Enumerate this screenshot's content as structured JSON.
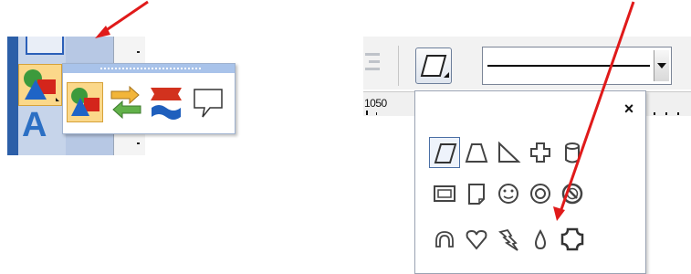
{
  "annotations": {
    "arrow_color": "#e01a1a"
  },
  "left_toolbox": {
    "active_tool_icon": "shapes-tool-icon",
    "text_tool_label": "A",
    "flyout": {
      "grip_icon": "flyout-grip-icon",
      "items": [
        {
          "icon": "basic-shapes-icon",
          "selected": true
        },
        {
          "icon": "connector-arrows-icon",
          "selected": false
        },
        {
          "icon": "banner-shapes-icon",
          "selected": false
        },
        {
          "icon": "callout-shapes-icon",
          "selected": false
        }
      ]
    }
  },
  "right_toolbar": {
    "shape_button_icon": "parallelogram-icon",
    "line_style_dropdown_icon": "dropdown-arrow-icon",
    "ruler_label": "1050",
    "palette": {
      "close_label": "×",
      "rows": [
        [
          "parallelogram-icon",
          "trapezoid-icon",
          "right-triangle-icon",
          "cross-icon",
          "cylinder-icon"
        ],
        [
          "frame-icon",
          "folded-corner-icon",
          "smiley-icon",
          "donut-icon",
          "no-symbol-icon"
        ],
        [
          "arc-icon",
          "heart-icon",
          "lightning-icon",
          "drop-icon",
          "plaque-icon"
        ]
      ]
    }
  }
}
